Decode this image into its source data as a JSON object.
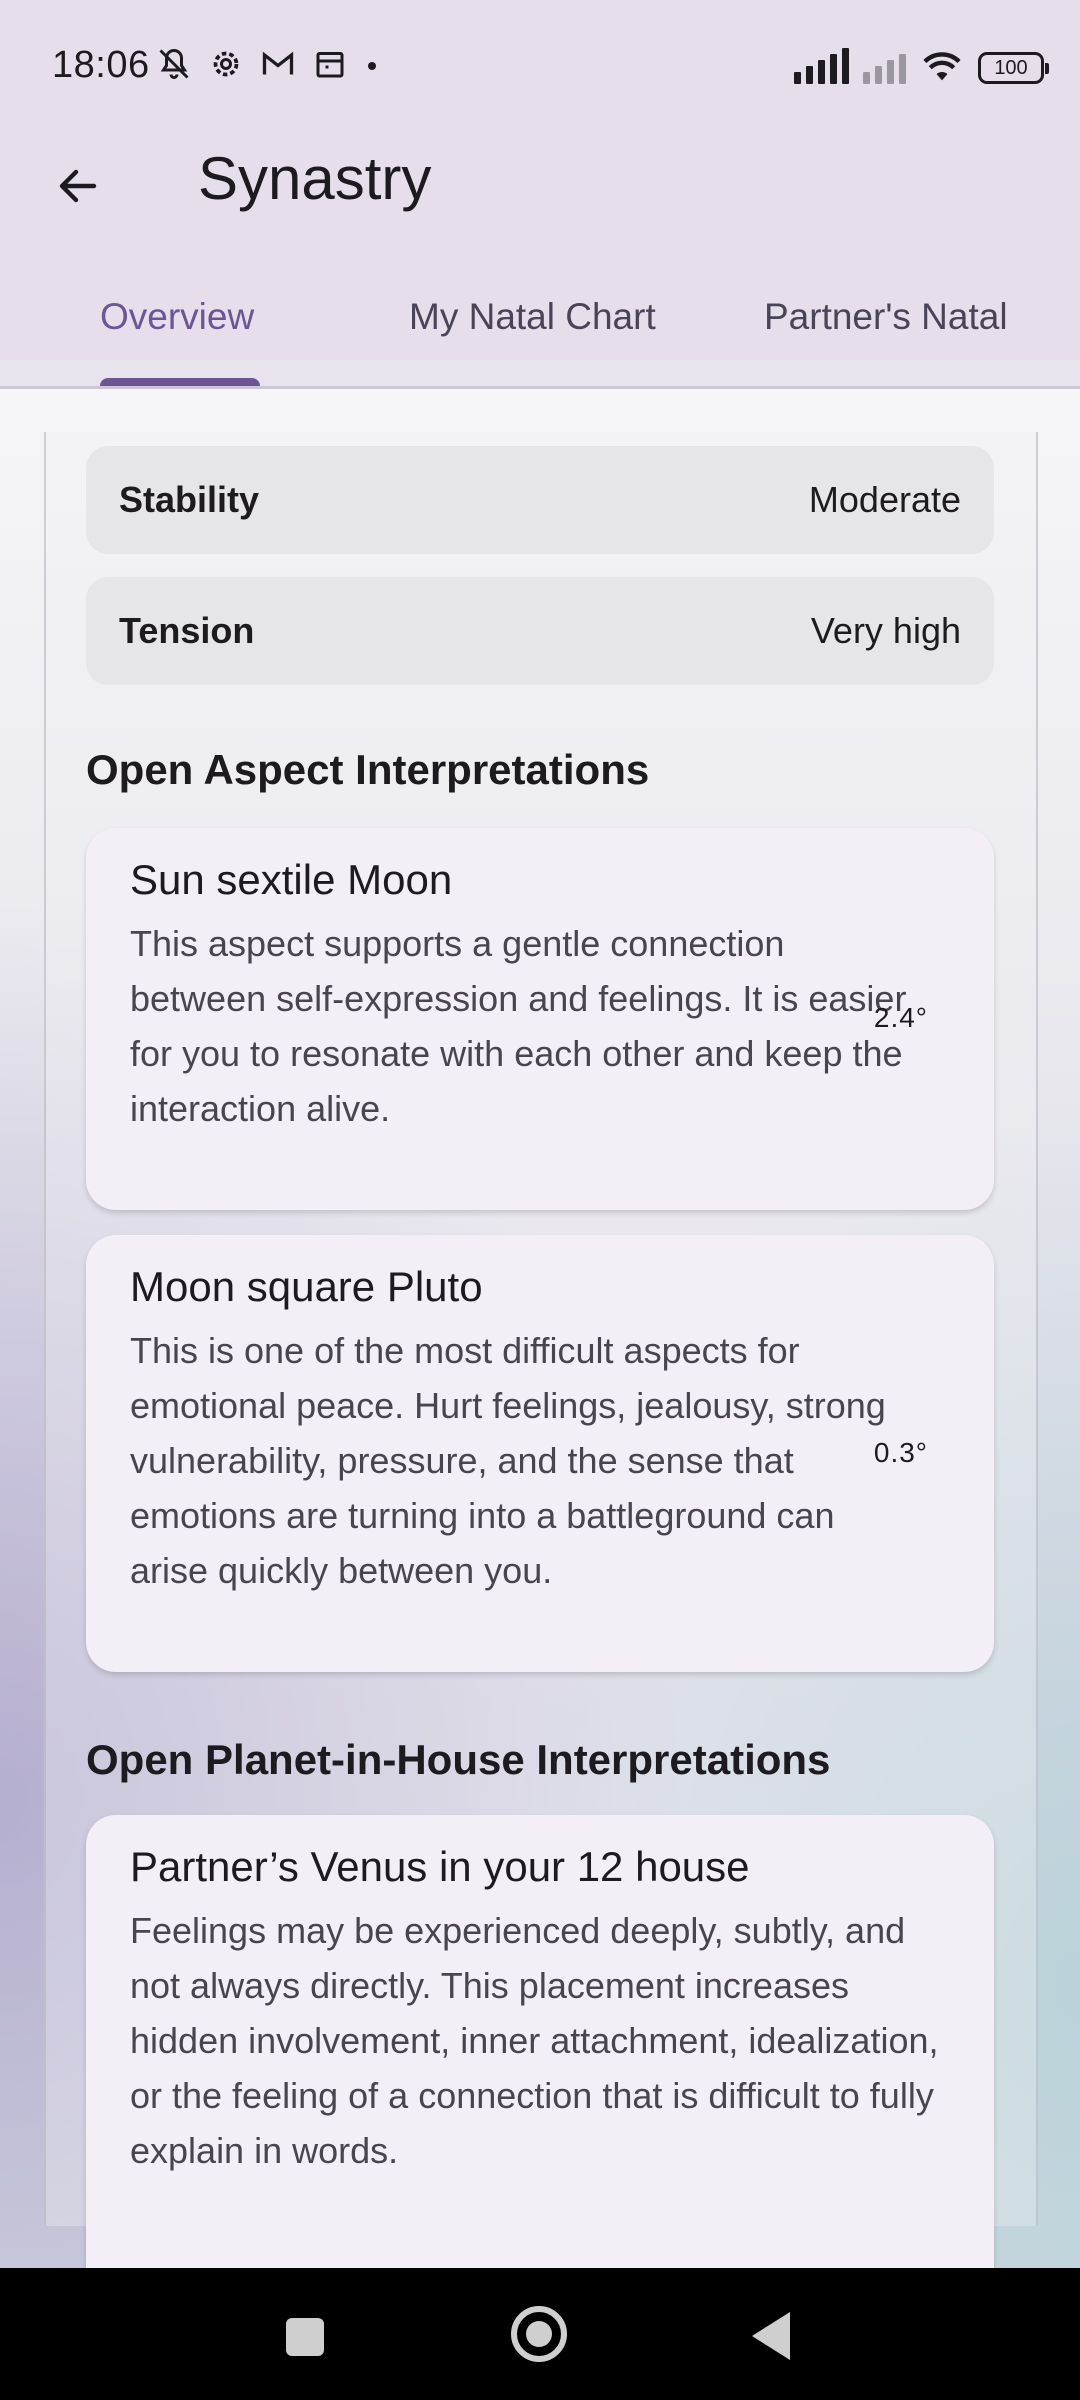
{
  "status_bar": {
    "time": "18:06",
    "left_icons": [
      "bell-off-icon",
      "settings-icon",
      "gmail-icon",
      "calendar-icon"
    ],
    "battery": "100"
  },
  "app_bar": {
    "title": "Synastry",
    "back_icon": "arrow-left-icon"
  },
  "tabs": [
    {
      "label": "Overview",
      "active": true
    },
    {
      "label": "My Natal Chart",
      "active": false
    },
    {
      "label": "Partner's Natal",
      "active": false
    }
  ],
  "metrics": [
    {
      "label": "Stability",
      "value": "Moderate"
    },
    {
      "label": "Tension",
      "value": "Very high"
    }
  ],
  "aspects_section": {
    "title": "Open Aspect Interpretations",
    "cards": [
      {
        "title": "Sun sextile Moon",
        "body": "This aspect supports a gentle connection between self-expression and feelings. It is easier for you to resonate with each other and keep the interaction alive.",
        "orb": "2.4°"
      },
      {
        "title": "Moon square Pluto",
        "body": "This is one of the most difficult aspects for emotional peace. Hurt feelings, jealousy, strong vulnerability, pressure, and the sense that emotions are turning into a battleground can arise quickly between you.",
        "orb": "0.3°"
      }
    ]
  },
  "houses_section": {
    "title": "Open Planet-in-House Interpretations",
    "cards": [
      {
        "title": "Partner’s Venus in your 12 house",
        "body": "Feelings may be experienced deeply, subtly, and not always directly. This placement increases hidden involvement, inner attachment, idealization, or the feeling of a connection that is difficult to fully explain in words."
      }
    ]
  },
  "nav_bar": {
    "buttons": [
      "recents-button",
      "home-button",
      "back-button"
    ]
  }
}
